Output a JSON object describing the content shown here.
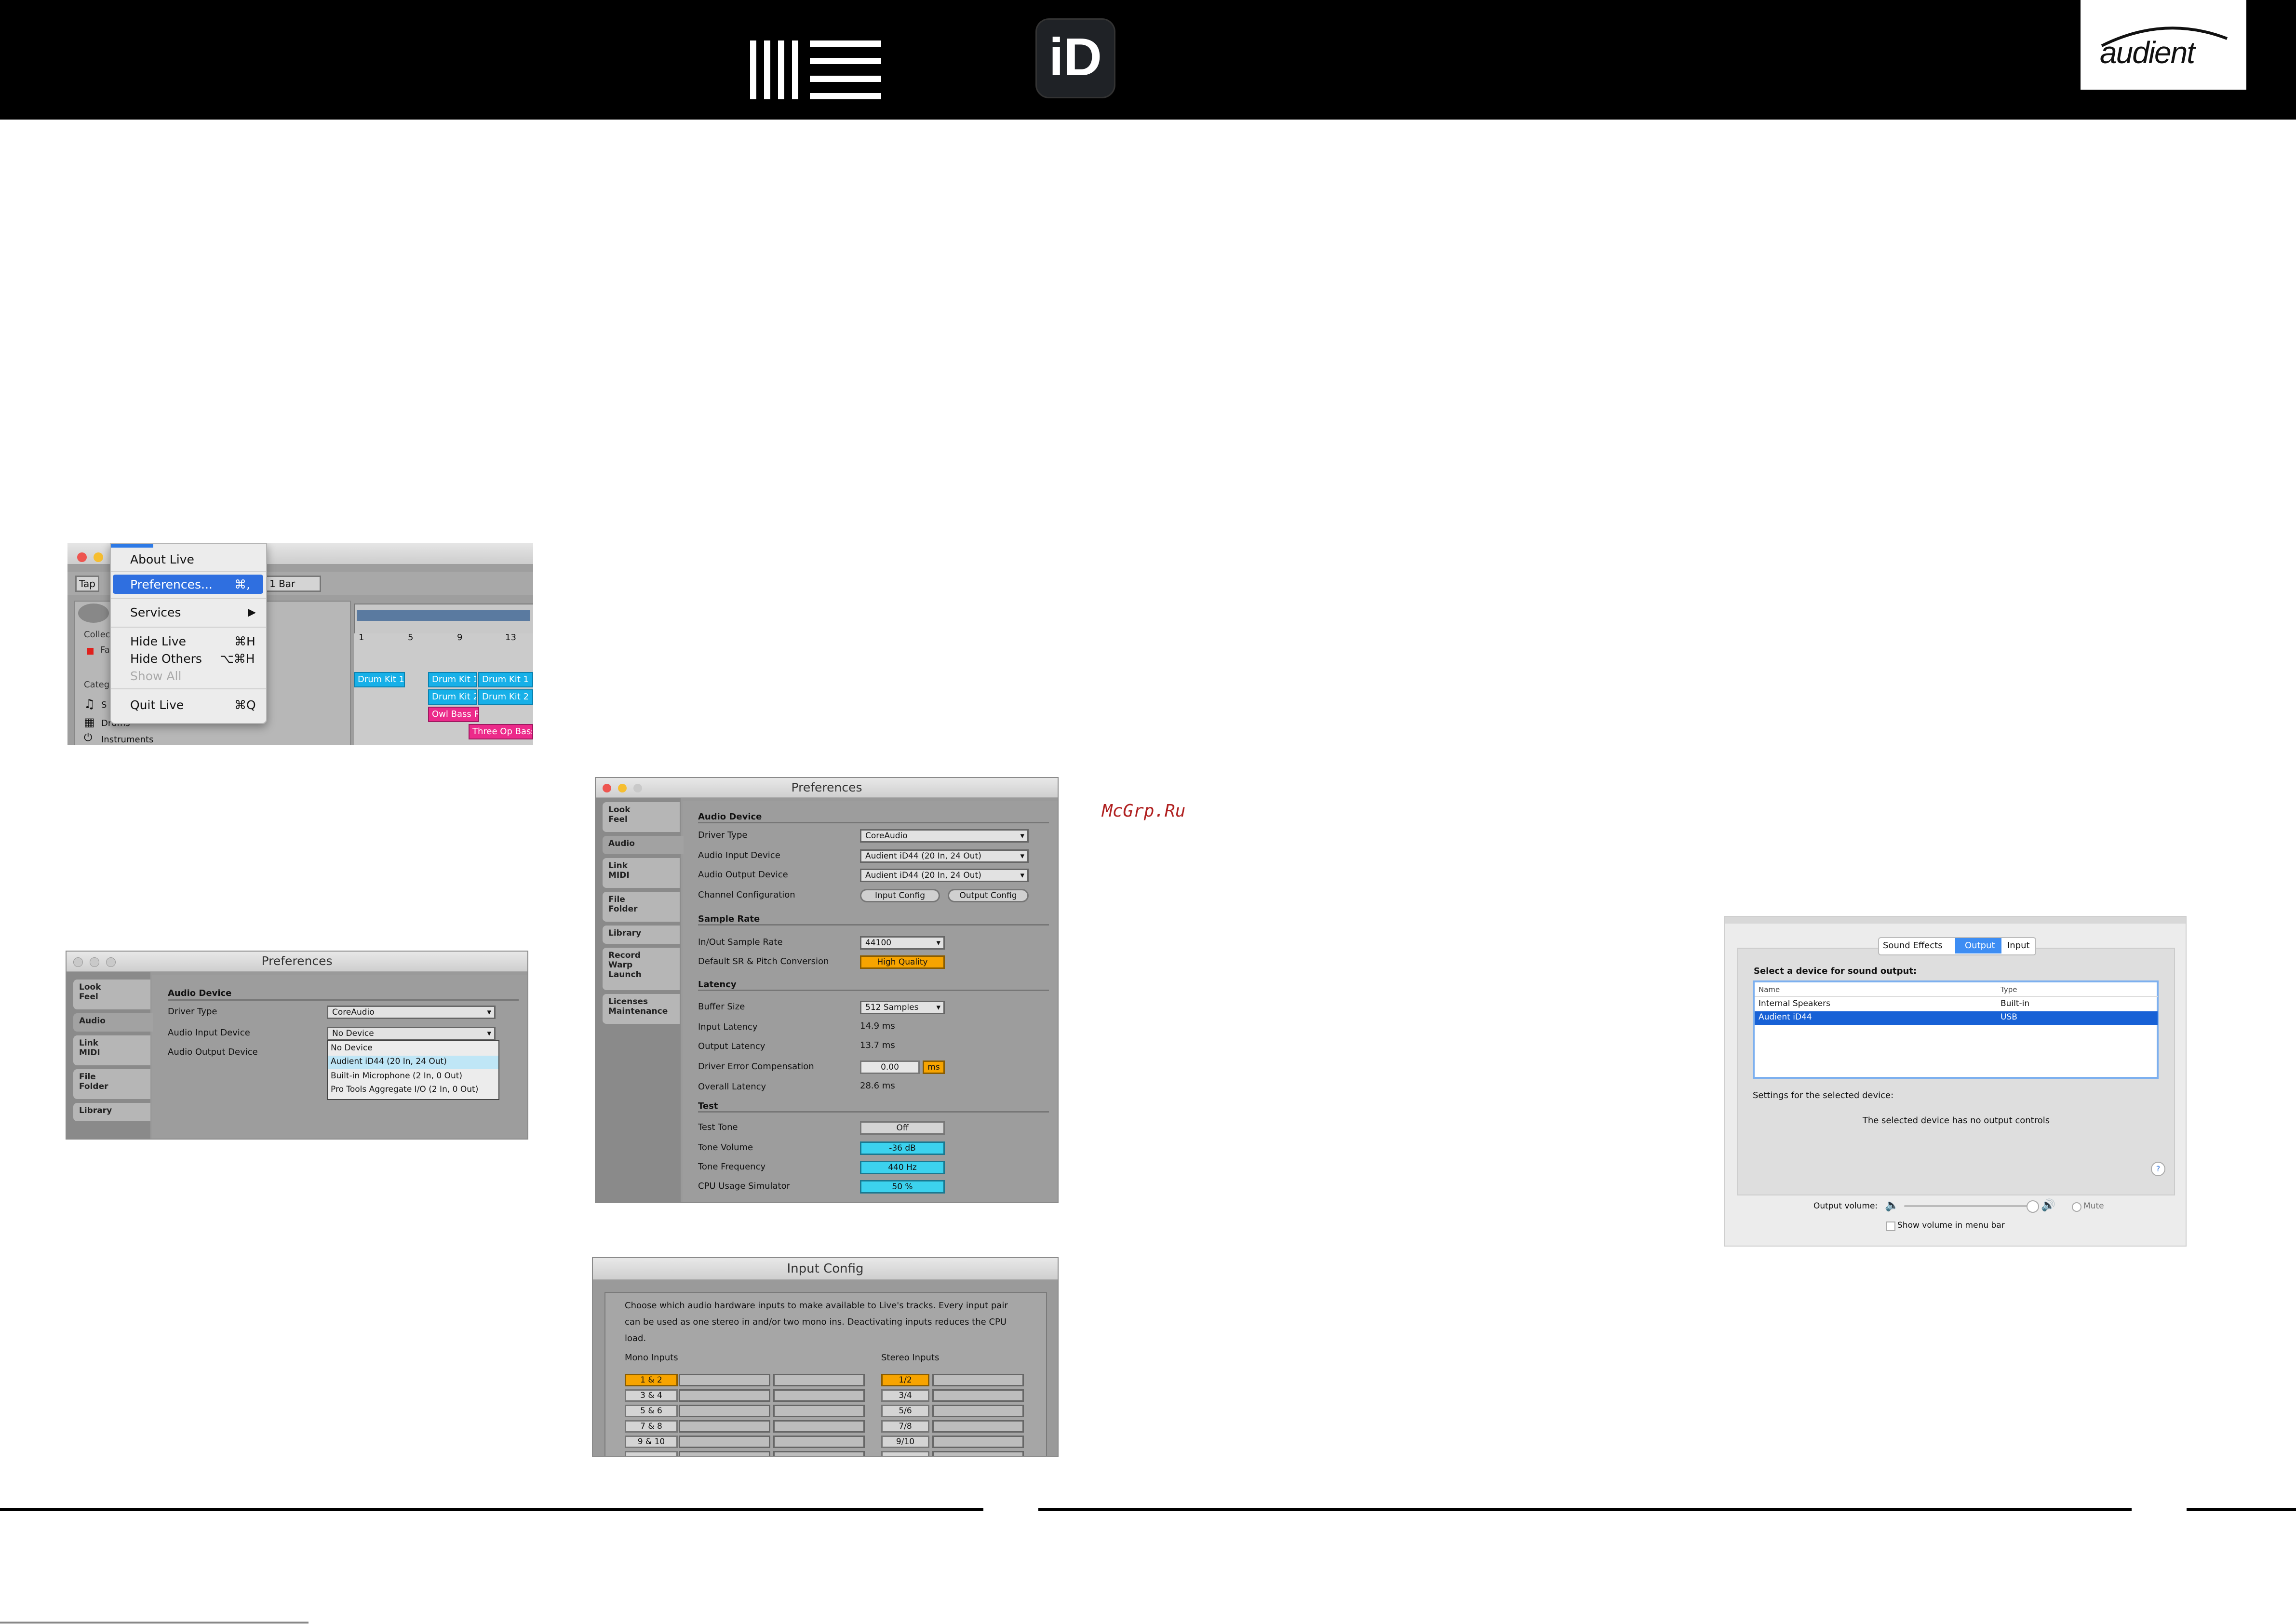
{
  "header": {
    "id_logo_text": "iD",
    "audient_logo_text": "audient"
  },
  "watermark": "McGrp.Ru",
  "live_menu": {
    "items": [
      {
        "label": "About Live",
        "shortcut": ""
      },
      {
        "label": "Preferences...",
        "shortcut": "⌘,"
      },
      {
        "label": "Services",
        "shortcut": "▶"
      },
      {
        "label": "Hide Live",
        "shortcut": "⌘H"
      },
      {
        "label": "Hide Others",
        "shortcut": "⌥⌘H"
      },
      {
        "label": "Show All",
        "shortcut": ""
      },
      {
        "label": "Quit Live",
        "shortcut": "⌘Q"
      }
    ],
    "toolbar": {
      "tap": "Tap",
      "bar": "1 Bar"
    },
    "browser": {
      "collections": "Collec",
      "fav": "Fa",
      "categories": "Categ",
      "sounds": "S",
      "drums": "Drums",
      "instruments": "Instruments"
    },
    "ruler": [
      "1",
      "5",
      "9",
      "13"
    ],
    "clips": {
      "drum_kit_1": "Drum Kit 1",
      "drum_kit_2": "Drum Kit 2",
      "owl_bass": "Owl Bass Ra",
      "three_op_bass": "Three Op Bass"
    }
  },
  "prefs_small": {
    "title": "Preferences",
    "tabs": [
      "Look\nFeel",
      "Audio",
      "Link\nMIDI",
      "File\nFolder",
      "Library"
    ],
    "section": "Audio Device",
    "driver_type_label": "Driver Type",
    "driver_type_value": "CoreAudio",
    "input_label": "Audio Input Device",
    "input_value": "No Device",
    "output_label": "Audio Output Device",
    "dropdown_options": [
      "No Device",
      "Audient iD44 (20 In, 24 Out)",
      "Built-in Microphone (2 In, 0 Out)",
      "Pro Tools Aggregate I/O (2 In, 0 Out)"
    ]
  },
  "prefs_large": {
    "title": "Preferences",
    "tabs": [
      "Look\nFeel",
      "Audio",
      "Link\nMIDI",
      "File\nFolder",
      "Library",
      "Record\nWarp\nLaunch",
      "Licenses\nMaintenance"
    ],
    "audio_device": {
      "section": "Audio Device",
      "driver_type_label": "Driver Type",
      "driver_type_value": "CoreAudio",
      "input_label": "Audio Input Device",
      "input_value": "Audient iD44 (20 In, 24 Out)",
      "output_label": "Audio Output Device",
      "output_value": "Audient iD44 (20 In, 24 Out)",
      "channel_label": "Channel Configuration",
      "input_config": "Input Config",
      "output_config": "Output Config"
    },
    "sample_rate": {
      "section": "Sample Rate",
      "rate_label": "In/Out Sample Rate",
      "rate_value": "44100",
      "conv_label": "Default SR & Pitch Conversion",
      "conv_value": "High Quality"
    },
    "latency": {
      "section": "Latency",
      "buffer_label": "Buffer Size",
      "buffer_value": "512 Samples",
      "input_latency_label": "Input Latency",
      "input_latency_value": "14.9 ms",
      "output_latency_label": "Output Latency",
      "output_latency_value": "13.7 ms",
      "comp_label": "Driver Error Compensation",
      "comp_value": "0.00",
      "comp_unit": "ms",
      "overall_label": "Overall Latency",
      "overall_value": "28.6 ms"
    },
    "test": {
      "section": "Test",
      "tone_label": "Test Tone",
      "tone_value": "Off",
      "volume_label": "Tone Volume",
      "volume_value": "-36 dB",
      "freq_label": "Tone Frequency",
      "freq_value": "440 Hz",
      "cpu_label": "CPU Usage Simulator",
      "cpu_value": "50 %"
    }
  },
  "input_config": {
    "title": "Input Config",
    "description": "Choose which audio hardware inputs to make available to Live's tracks. Every input pair can be used as one stereo in and/or two mono ins.  Deactivating inputs reduces the CPU load.",
    "mono_label": "Mono Inputs",
    "stereo_label": "Stereo Inputs",
    "mono": [
      "1 & 2",
      "3 & 4",
      "5 & 6",
      "7 & 8",
      "9 & 10"
    ],
    "stereo": [
      "1/2",
      "3/4",
      "5/6",
      "7/8",
      "9/10"
    ]
  },
  "mac_sound": {
    "tabs": [
      "Sound Effects",
      "Output",
      "Input"
    ],
    "heading": "Select a device for sound output:",
    "col_name": "Name",
    "col_type": "Type",
    "rows": [
      {
        "name": "Internal Speakers",
        "type": "Built-in"
      },
      {
        "name": "Audient iD44",
        "type": "USB"
      }
    ],
    "settings_label": "Settings for the selected device:",
    "no_controls": "The selected device has no output controls",
    "help": "?",
    "output_volume_label": "Output volume:",
    "mute_label": "Mute",
    "show_volume_label": "Show volume in menu bar"
  },
  "colors": {
    "accent_blue": "#1e6fd9",
    "live_orange": "#f7a400",
    "live_cyan": "#3cd2ee",
    "clip_blue": "#17b0e8",
    "clip_pink": "#ec2a8a"
  }
}
